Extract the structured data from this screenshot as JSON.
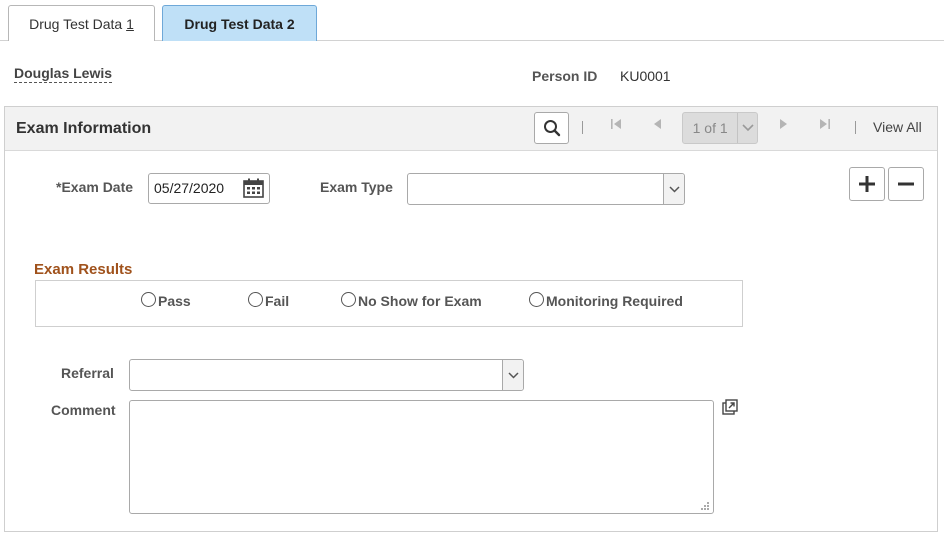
{
  "tabs": [
    {
      "label_prefix": "Drug Test Data ",
      "label_num": "1",
      "active": false
    },
    {
      "label": "Drug Test Data 2",
      "active": true
    }
  ],
  "header": {
    "person_name": "Douglas Lewis",
    "person_id_label": "Person ID",
    "person_id_value": "KU0001"
  },
  "panel": {
    "title": "Exam Information",
    "pager_text": "1 of 1",
    "view_all": "View All"
  },
  "form": {
    "exam_date_label": "*Exam Date",
    "exam_date_value": "05/27/2020",
    "exam_type_label": "Exam Type",
    "exam_type_value": "",
    "exam_results_title": "Exam Results",
    "exam_results_options": [
      "Pass",
      "Fail",
      "No Show for Exam",
      "Monitoring Required"
    ],
    "referral_label": "Referral",
    "referral_value": "",
    "comment_label": "Comment",
    "comment_value": ""
  },
  "colors": {
    "active_tab_bg": "#bfe0f7",
    "section_title": "#a0521c"
  },
  "icons": [
    "search-icon",
    "first-page-icon",
    "previous-icon",
    "next-icon",
    "last-page-icon",
    "calendar-icon",
    "chevron-down-icon",
    "add-row-icon",
    "delete-row-icon",
    "expand-icon"
  ]
}
